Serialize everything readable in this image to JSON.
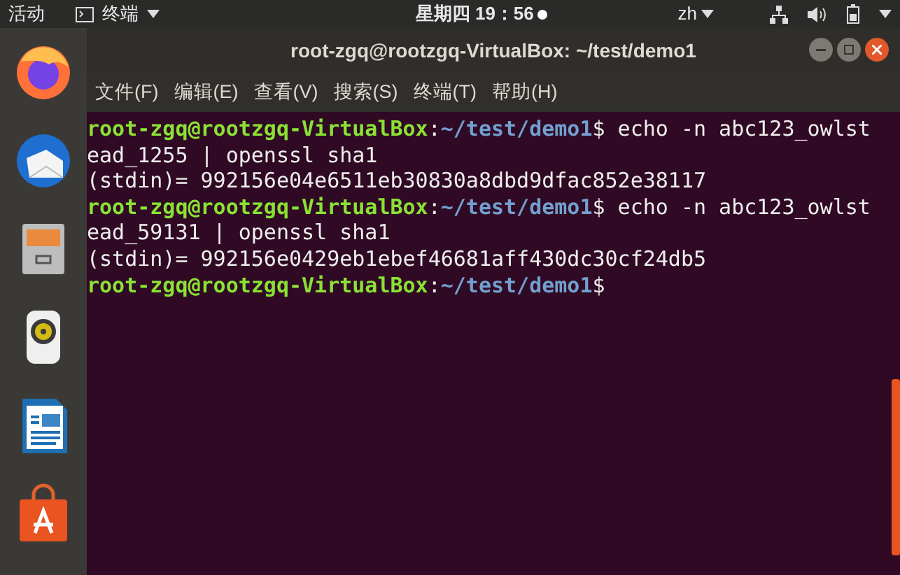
{
  "top_bar": {
    "activities": "活动",
    "app_menu": "终端",
    "clock": "星期四 19：56",
    "input_method": "zh"
  },
  "window": {
    "title": "root-zgq@rootzgq-VirtualBox: ~/test/demo1"
  },
  "menu": [
    "文件(F)",
    "编辑(E)",
    "查看(V)",
    "搜索(S)",
    "终端(T)",
    "帮助(H)"
  ],
  "terminal_lines": [
    {
      "segments": [
        {
          "kind": "host",
          "text": "root-zgq@rootzgq-VirtualBox"
        },
        {
          "kind": "plain",
          "text": ":"
        },
        {
          "kind": "path",
          "text": "~/test/demo1"
        },
        {
          "kind": "plain",
          "text": "$ echo -n abc123_owlst"
        }
      ]
    },
    {
      "segments": [
        {
          "kind": "plain",
          "text": "ead_1255 | openssl sha1"
        }
      ]
    },
    {
      "segments": [
        {
          "kind": "plain",
          "text": "(stdin)= 992156e04e6511eb30830a8dbd9dfac852e38117"
        }
      ]
    },
    {
      "segments": [
        {
          "kind": "host",
          "text": "root-zgq@rootzgq-VirtualBox"
        },
        {
          "kind": "plain",
          "text": ":"
        },
        {
          "kind": "path",
          "text": "~/test/demo1"
        },
        {
          "kind": "plain",
          "text": "$ echo -n abc123_owlst"
        }
      ]
    },
    {
      "segments": [
        {
          "kind": "plain",
          "text": "ead_59131 | openssl sha1"
        }
      ]
    },
    {
      "segments": [
        {
          "kind": "plain",
          "text": "(stdin)= 992156e0429eb1ebef46681aff430dc30cf24db5"
        }
      ]
    },
    {
      "segments": [
        {
          "kind": "host",
          "text": "root-zgq@rootzgq-VirtualBox"
        },
        {
          "kind": "plain",
          "text": ":"
        },
        {
          "kind": "path",
          "text": "~/test/demo1"
        },
        {
          "kind": "plain",
          "text": "$"
        }
      ]
    }
  ]
}
